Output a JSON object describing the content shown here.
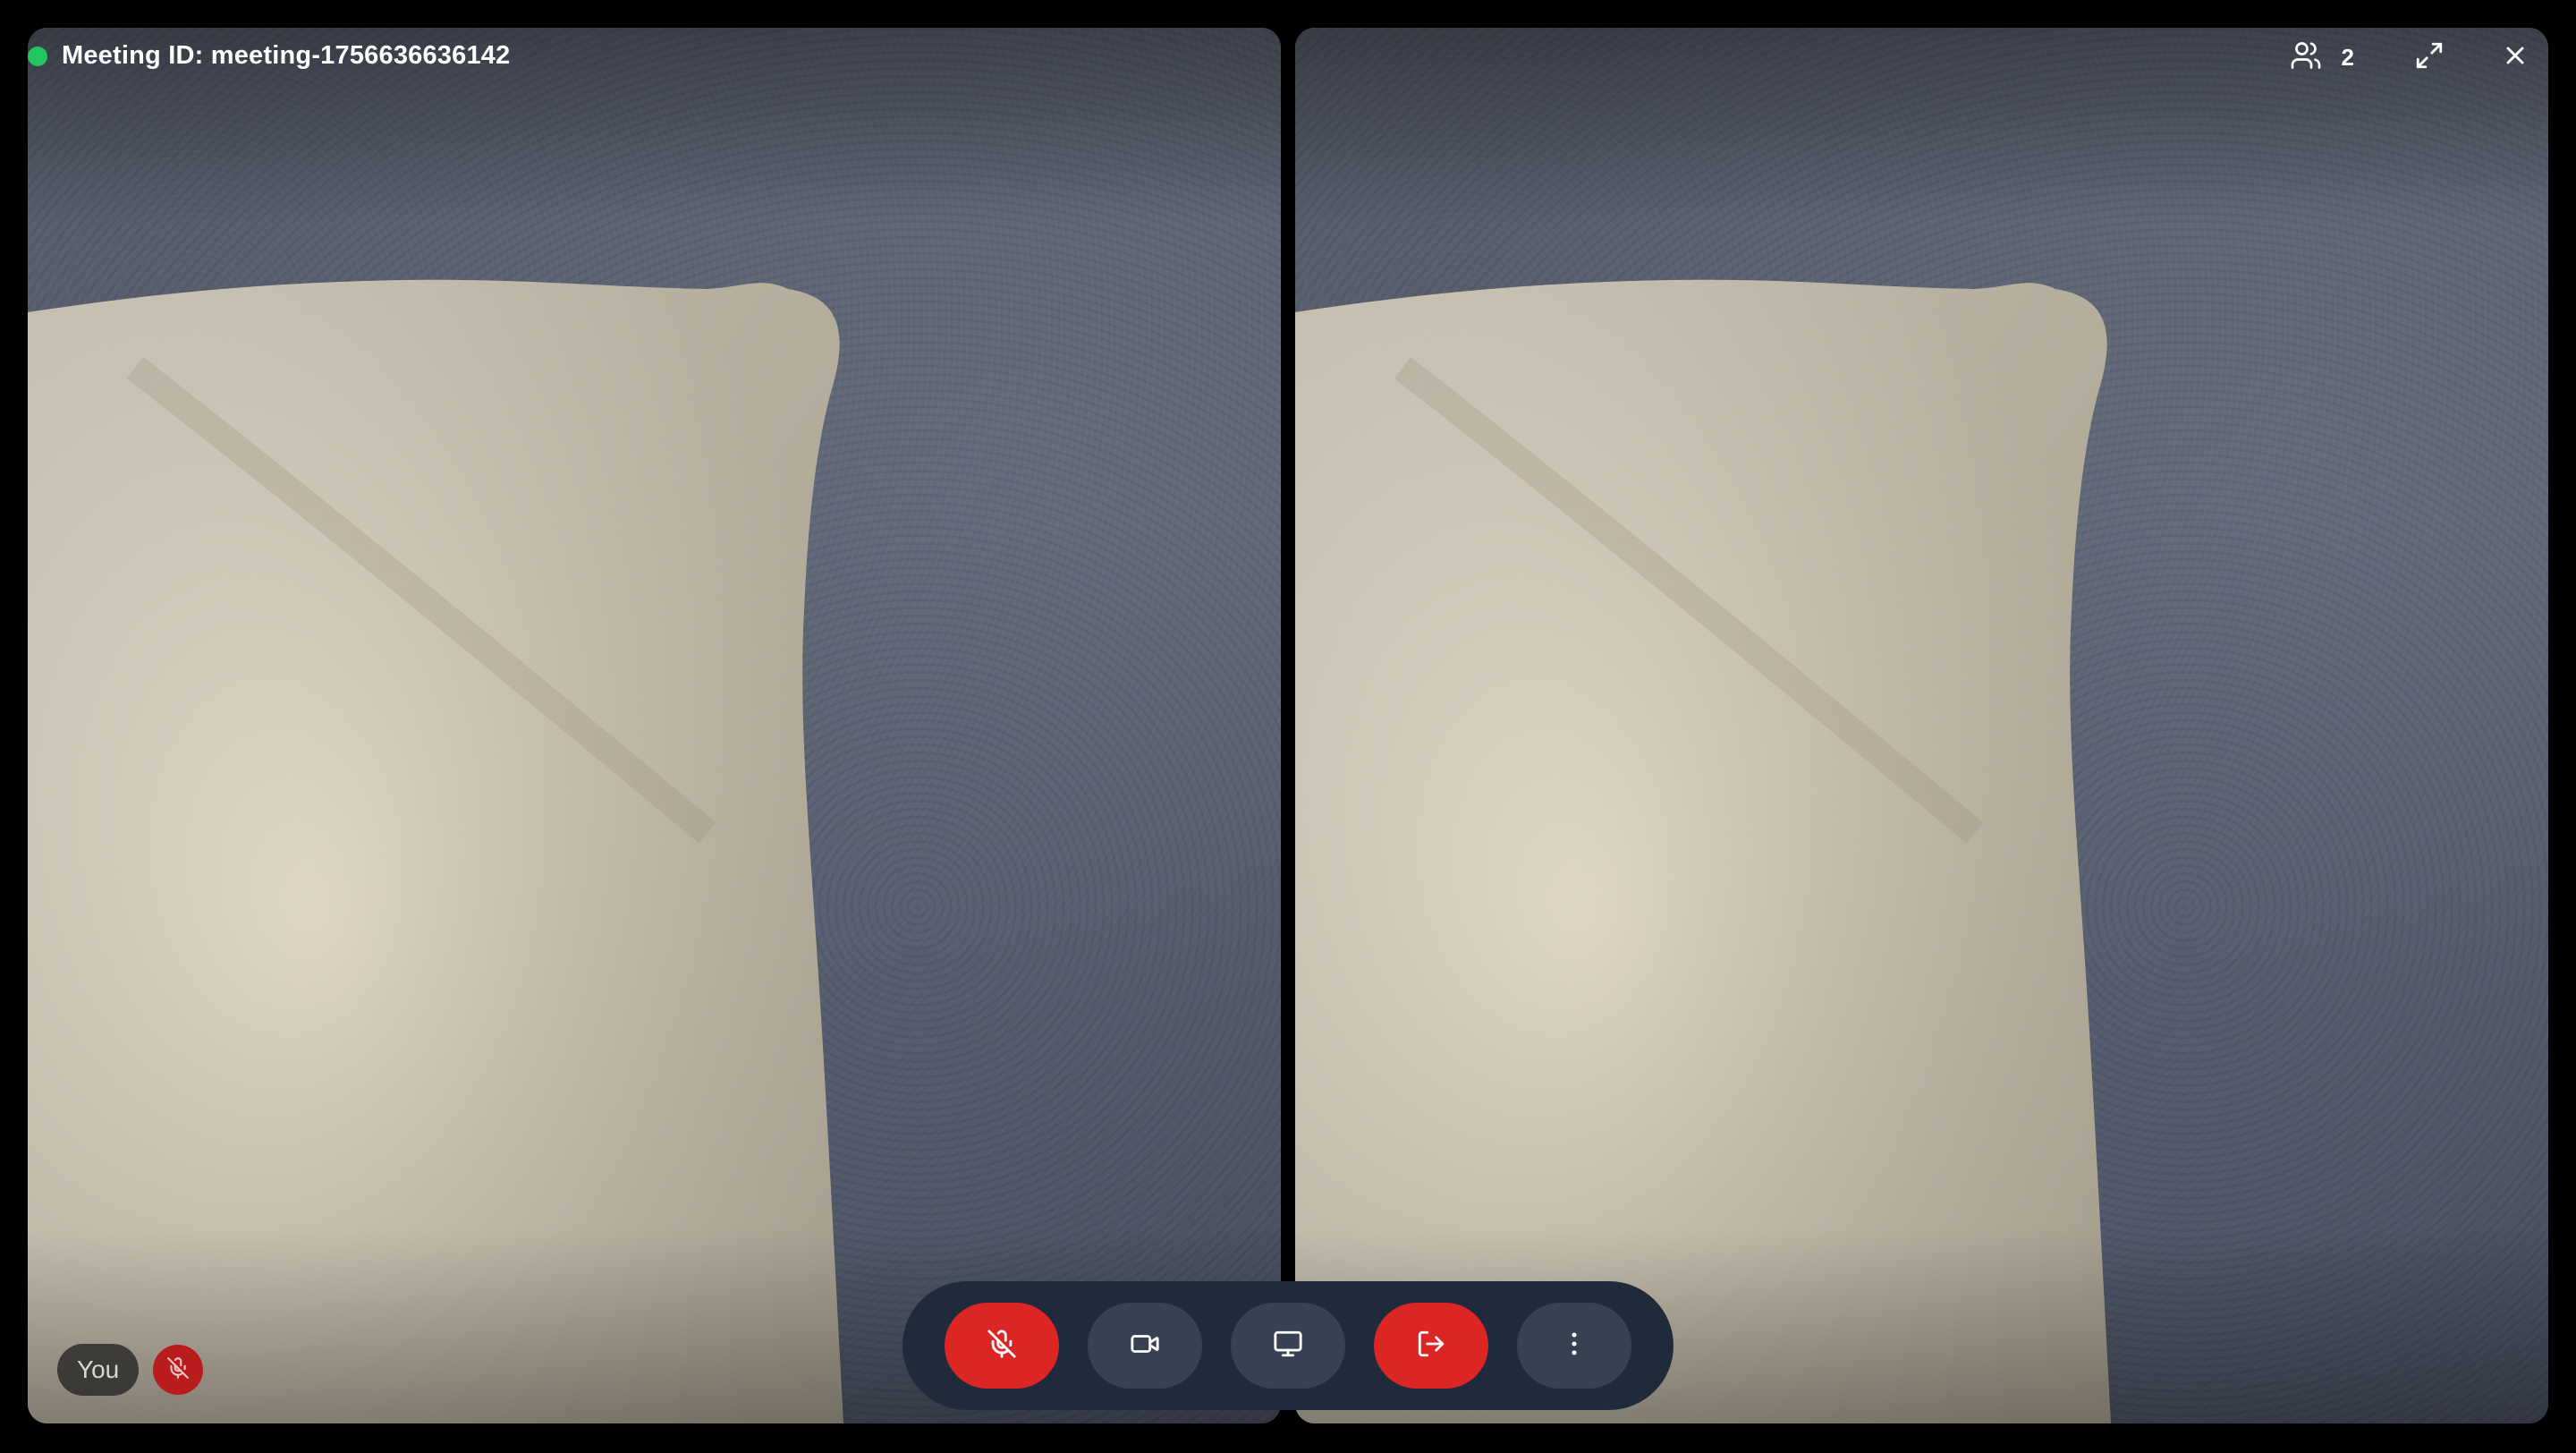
{
  "header": {
    "meeting_label": "Meeting ID: meeting-1756636636142",
    "status_color": "#22c55e",
    "participant_count": "2",
    "icons": {
      "participants": "users-icon",
      "expand": "expand-icon",
      "close": "close-icon"
    }
  },
  "tiles": [
    {
      "id": "local",
      "name": "You",
      "muted": true
    },
    {
      "id": "remote"
    }
  ],
  "controls": [
    {
      "name": "mute-toggle",
      "icon": "mic-off-icon",
      "active_color": "#dc2626"
    },
    {
      "name": "camera-toggle",
      "icon": "video-icon"
    },
    {
      "name": "screen-share",
      "icon": "monitor-icon"
    },
    {
      "name": "leave-meeting",
      "icon": "logout-icon",
      "active_color": "#dc2626"
    },
    {
      "name": "more-options",
      "icon": "more-vertical-icon"
    }
  ],
  "colors": {
    "danger": "#dc2626",
    "control_bar": "#212a3a",
    "control_button": "#374152",
    "live": "#22c55e"
  }
}
